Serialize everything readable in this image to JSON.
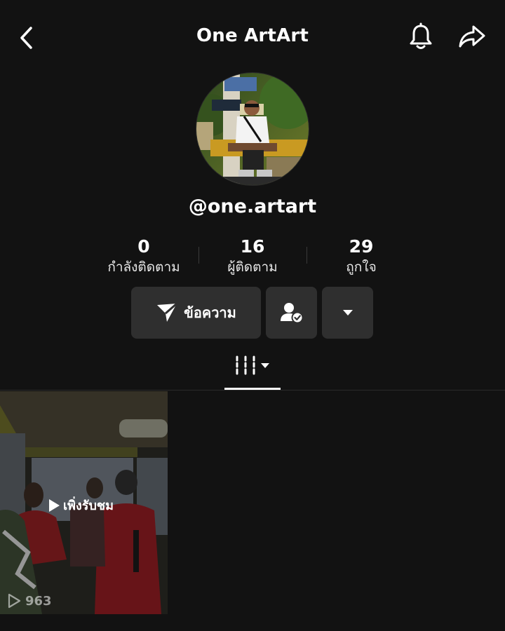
{
  "header": {
    "title": "One ArtArt",
    "back_icon": "chevron-left-icon",
    "bell_icon": "bell-icon",
    "share_icon": "share-arrow-icon"
  },
  "profile": {
    "username": "@one.artart",
    "avatar_description": "profile-photo"
  },
  "stats": [
    {
      "value": "0",
      "label": "กำลังติดตาม"
    },
    {
      "value": "16",
      "label": "ผู้ติดตาม"
    },
    {
      "value": "29",
      "label": "ถูกใจ"
    }
  ],
  "actions": {
    "message_label": "ข้อความ",
    "message_icon": "send-icon",
    "friend_icon": "user-check-icon",
    "more_icon": "caret-down-icon"
  },
  "tabs": {
    "active_icon": "grid-bars-icon"
  },
  "videos": [
    {
      "badge": "เพิ่งรับชม",
      "views": "963"
    }
  ],
  "colors": {
    "background": "#121212",
    "button": "#2f2f2f",
    "text": "#ffffff"
  }
}
